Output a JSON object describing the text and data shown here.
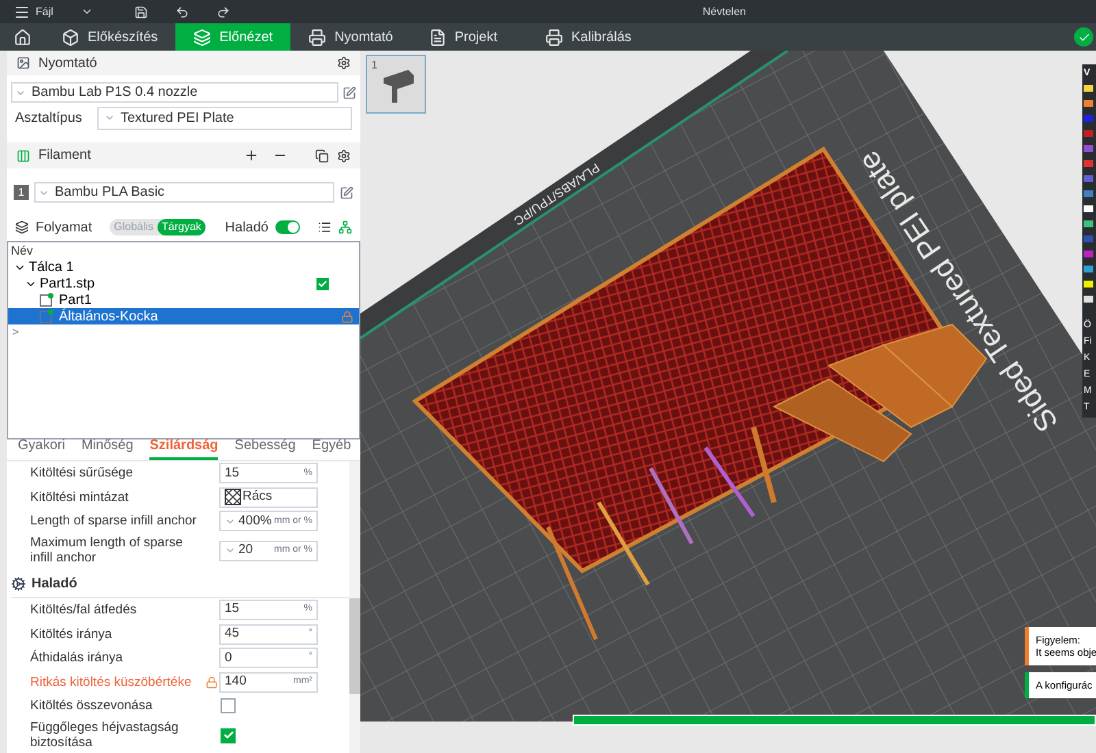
{
  "menu": {
    "file": "Fájl"
  },
  "window": {
    "title": "Névtelen"
  },
  "tabs": [
    {
      "label": "Előkészítés",
      "selected": false
    },
    {
      "label": "Előnézet",
      "selected": true
    },
    {
      "label": "Nyomtató",
      "selected": false
    },
    {
      "label": "Projekt",
      "selected": false
    },
    {
      "label": "Kalibrálás",
      "selected": false
    }
  ],
  "printer": {
    "title": "Nyomtató",
    "preset": "Bambu Lab P1S 0.4 nozzle",
    "plate_label": "Asztaltípus",
    "plate": "Textured PEI Plate"
  },
  "filament": {
    "title": "Filament",
    "items": [
      {
        "index": "1",
        "name": "Bambu PLA Basic"
      }
    ]
  },
  "process": {
    "title": "Folyamat",
    "scopes": [
      {
        "label": "Globális",
        "selected": false
      },
      {
        "label": "Tárgyak",
        "selected": true
      }
    ],
    "advanced_label": "Haladó",
    "advanced_on": true
  },
  "object_list": {
    "column": "Név",
    "items": [
      {
        "name": "Tálca 1",
        "expanded": true,
        "children": [
          {
            "name": "Part1.stp",
            "expanded": true,
            "checked": true,
            "children": [
              {
                "name": "Part1",
                "kind": "part",
                "selected": false,
                "locked": false
              },
              {
                "name": "Általános-Kocka",
                "kind": "part",
                "selected": true,
                "locked": true
              }
            ]
          }
        ]
      }
    ],
    "more": ">"
  },
  "settings_tabs": [
    {
      "label": "Gyakori",
      "selected": false
    },
    {
      "label": "Minőség",
      "selected": false
    },
    {
      "label": "Szilárdság",
      "selected": true
    },
    {
      "label": "Sebesség",
      "selected": false
    },
    {
      "label": "Egyéb",
      "selected": false
    }
  ],
  "settings": [
    {
      "kind": "input",
      "label": "Kitöltési sűrűsége",
      "value": "15",
      "unit": "%",
      "modified": false
    },
    {
      "kind": "pattern",
      "label": "Kitöltési mintázat",
      "value": "Rács",
      "modified": false
    },
    {
      "kind": "combo",
      "label": "Length of sparse infill anchor",
      "value": "400%",
      "unit": "mm or %",
      "modified": false
    },
    {
      "kind": "combo",
      "label": "Maximum length of sparse infill anchor",
      "value": "20",
      "unit": "mm or %",
      "modified": false
    },
    {
      "kind": "heading",
      "label": "Haladó"
    },
    {
      "kind": "input",
      "label": "Kitöltés/fal átfedés",
      "value": "15",
      "unit": "%",
      "modified": false
    },
    {
      "kind": "input",
      "label": "Kitöltés iránya",
      "value": "45",
      "unit": "°",
      "modified": false
    },
    {
      "kind": "input",
      "label": "Áthidalás iránya",
      "value": "0",
      "unit": "°",
      "modified": false
    },
    {
      "kind": "input",
      "label": "Ritkás kitöltés küszöbértéke",
      "value": "140",
      "unit": "mm²",
      "modified": true
    },
    {
      "kind": "check",
      "label": "Kitöltés összevonása",
      "checked": false,
      "modified": false
    },
    {
      "kind": "check",
      "label": "Függőleges héjvastagság biztosítása",
      "checked": true,
      "modified": false
    }
  ],
  "plate_thumbnail": {
    "number": "1"
  },
  "bed": {
    "label": "Sided Textured PEI plate",
    "filaments": "PLA/ABS/TPU/PC"
  },
  "legend": {
    "title": "V",
    "colors": [
      {
        "color": "#f5d442"
      },
      {
        "color": "#f08030"
      },
      {
        "color": "#2020e0"
      },
      {
        "color": "#c02020"
      },
      {
        "color": "#9050d0"
      },
      {
        "color": "#e03030"
      },
      {
        "color": "#6060d0"
      },
      {
        "color": "#4080c0"
      },
      {
        "color": "#ffffff"
      },
      {
        "color": "#40c080"
      },
      {
        "color": "#3050b0"
      },
      {
        "color": "#c020c0"
      },
      {
        "color": "#30a0d0"
      },
      {
        "color": "#f0f000"
      },
      {
        "color": "#e0e0e0"
      }
    ],
    "section": "Ö",
    "rows": [
      "Fi",
      "K",
      "E",
      "M",
      "T"
    ]
  },
  "notifications": [
    {
      "kind": "warning",
      "title": "Figyelem:",
      "text": "It seems obje"
    },
    {
      "kind": "info",
      "text": "A konfigurác"
    }
  ],
  "progress": {
    "level": 1
  }
}
